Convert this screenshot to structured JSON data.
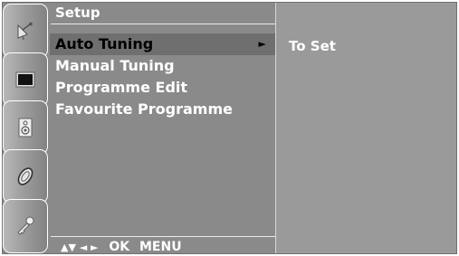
{
  "menu": {
    "title": "Setup",
    "items": [
      {
        "label": "Auto Tuning",
        "arrow": "►"
      },
      {
        "label": "Manual Tuning"
      },
      {
        "label": "Programme Edit"
      },
      {
        "label": "Favourite Programme"
      }
    ],
    "selected": "Auto Tuning"
  },
  "footer": {
    "nav_arrows": "▲▼ ◄ ►",
    "ok": "OK",
    "menu": "MENU"
  },
  "subpanel": {
    "title": "To Set"
  },
  "sidebar": {
    "icons": [
      "satellite-dish-icon",
      "screen-icon",
      "speaker-icon",
      "disc-icon",
      "key-icon"
    ],
    "active": "satellite-dish-icon"
  },
  "colors": {
    "background": "#8a8a8a",
    "selection": "#6f6f6f",
    "subpanel": "#9a9a9a",
    "text": "#ffffff"
  }
}
